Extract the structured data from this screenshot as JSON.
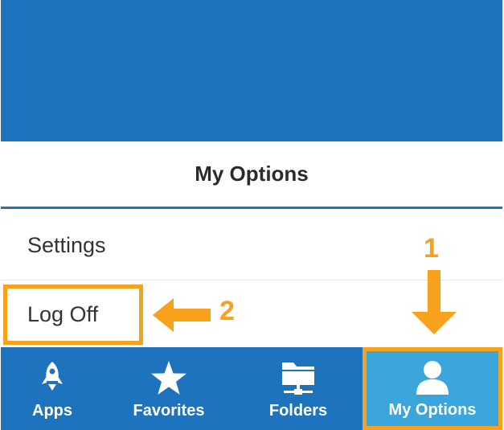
{
  "colors": {
    "brand_blue": "#1e73be",
    "active_tab": "#3aa6dc",
    "annotation_orange": "#f7a11c"
  },
  "header": {
    "title": "My Options"
  },
  "menu": {
    "items": [
      {
        "label": "Settings"
      },
      {
        "label": "Log Off"
      }
    ]
  },
  "annotations": {
    "step1": "1",
    "step2": "2"
  },
  "tabbar": {
    "tabs": [
      {
        "label": "Apps",
        "icon": "rocket-icon"
      },
      {
        "label": "Favorites",
        "icon": "star-icon"
      },
      {
        "label": "Folders",
        "icon": "folder-icon"
      },
      {
        "label": "My Options",
        "icon": "user-icon",
        "active": true
      }
    ]
  }
}
